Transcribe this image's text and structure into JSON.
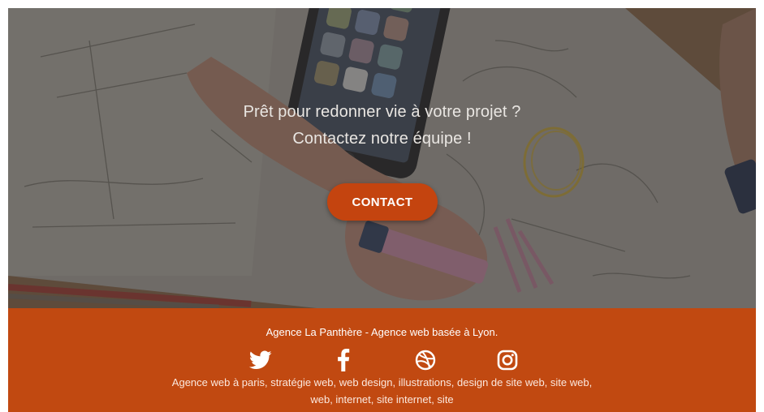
{
  "hero": {
    "line1": "Prêt pour redonner vie à votre projet ?",
    "line2": "Contactez notre équipe !",
    "cta_label": "CONTACT"
  },
  "footer": {
    "tagline": "Agence La Panthère - Agence web basée à Lyon.",
    "socials": [
      {
        "icon": "twitter-icon"
      },
      {
        "icon": "facebook-icon"
      },
      {
        "icon": "dribbble-icon"
      },
      {
        "icon": "instagram-icon"
      }
    ],
    "keywords": "Agence web à paris, stratégie web, web design, illustrations, design de site web, site web, web, internet, site internet, site"
  },
  "colors": {
    "accent": "#c14911",
    "button": "#c4440f",
    "hero_text": "#e9e6e2"
  }
}
